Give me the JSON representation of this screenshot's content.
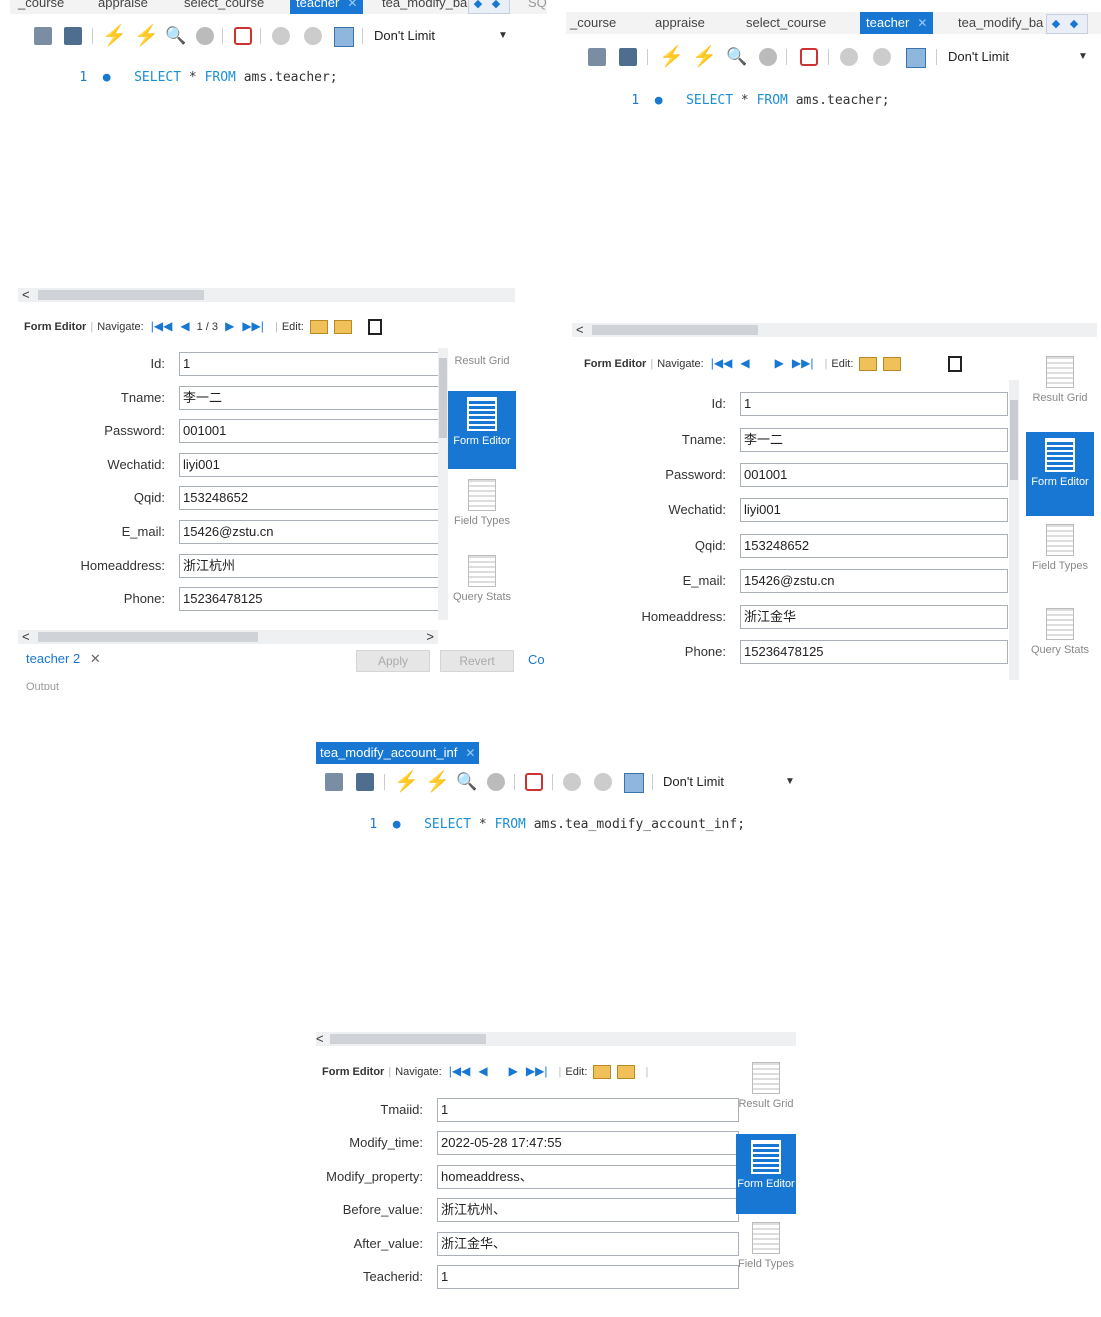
{
  "panel1": {
    "tabs": [
      "_course",
      "appraise",
      "select_course",
      "teacher",
      "tea_modify_ba",
      "SQL"
    ],
    "limit": "Don't Limit",
    "code": {
      "line": "1",
      "select": "SELECT",
      "star": "*",
      "from": "FROM",
      "rest": "ams.teacher;"
    },
    "fe": {
      "title": "Form Editor",
      "navigate": "Navigate:",
      "page": "1 / 3",
      "edit": "Edit:"
    },
    "fields": [
      {
        "label": "Id:",
        "value": "1"
      },
      {
        "label": "Tname:",
        "value": "李一二"
      },
      {
        "label": "Password:",
        "value": "001001"
      },
      {
        "label": "Wechatid:",
        "value": "liyi001"
      },
      {
        "label": "Qqid:",
        "value": "153248652"
      },
      {
        "label": "E_mail:",
        "value": "15426@zstu.cn"
      },
      {
        "label": "Homeaddress:",
        "value": "浙江杭州"
      },
      {
        "label": "Phone:",
        "value": "15236478125"
      }
    ],
    "side": [
      "Result Grid",
      "Form Editor",
      "Field Types",
      "Query Stats"
    ],
    "bottom_tab": "teacher 2",
    "apply": "Apply",
    "revert": "Revert",
    "output": "Output",
    "co": "Co"
  },
  "panel2": {
    "tabs": [
      "_course",
      "appraise",
      "select_course",
      "teacher",
      "tea_modify_ba"
    ],
    "limit": "Don't Limit",
    "code": {
      "line": "1",
      "select": "SELECT",
      "star": "*",
      "from": "FROM",
      "rest": "ams.teacher;"
    },
    "fe": {
      "title": "Form Editor",
      "navigate": "Navigate:",
      "edit": "Edit:"
    },
    "fields": [
      {
        "label": "Id:",
        "value": "1"
      },
      {
        "label": "Tname:",
        "value": "李一二"
      },
      {
        "label": "Password:",
        "value": "001001"
      },
      {
        "label": "Wechatid:",
        "value": "liyi001"
      },
      {
        "label": "Qqid:",
        "value": "153248652"
      },
      {
        "label": "E_mail:",
        "value": "15426@zstu.cn"
      },
      {
        "label": "Homeaddress:",
        "value": "浙江金华"
      },
      {
        "label": "Phone:",
        "value": "15236478125"
      }
    ],
    "side": [
      "Result Grid",
      "Form Editor",
      "Field Types",
      "Query Stats"
    ]
  },
  "panel3": {
    "tab": "tea_modify_account_inf",
    "limit": "Don't Limit",
    "code": {
      "line": "1",
      "select": "SELECT",
      "star": "*",
      "from": "FROM",
      "rest": "ams.tea_modify_account_inf;"
    },
    "fe": {
      "title": "Form Editor",
      "navigate": "Navigate:",
      "edit": "Edit:"
    },
    "fields": [
      {
        "label": "Tmaiid:",
        "value": "1"
      },
      {
        "label": "Modify_time:",
        "value": "2022-05-28 17:47:55"
      },
      {
        "label": "Modify_property:",
        "value": "homeaddress、"
      },
      {
        "label": "Before_value:",
        "value": "浙江杭州、"
      },
      {
        "label": "After_value:",
        "value": "浙江金华、"
      },
      {
        "label": "Teacherid:",
        "value": "1"
      }
    ],
    "side": [
      "Result Grid",
      "Form Editor",
      "Field Types"
    ]
  }
}
